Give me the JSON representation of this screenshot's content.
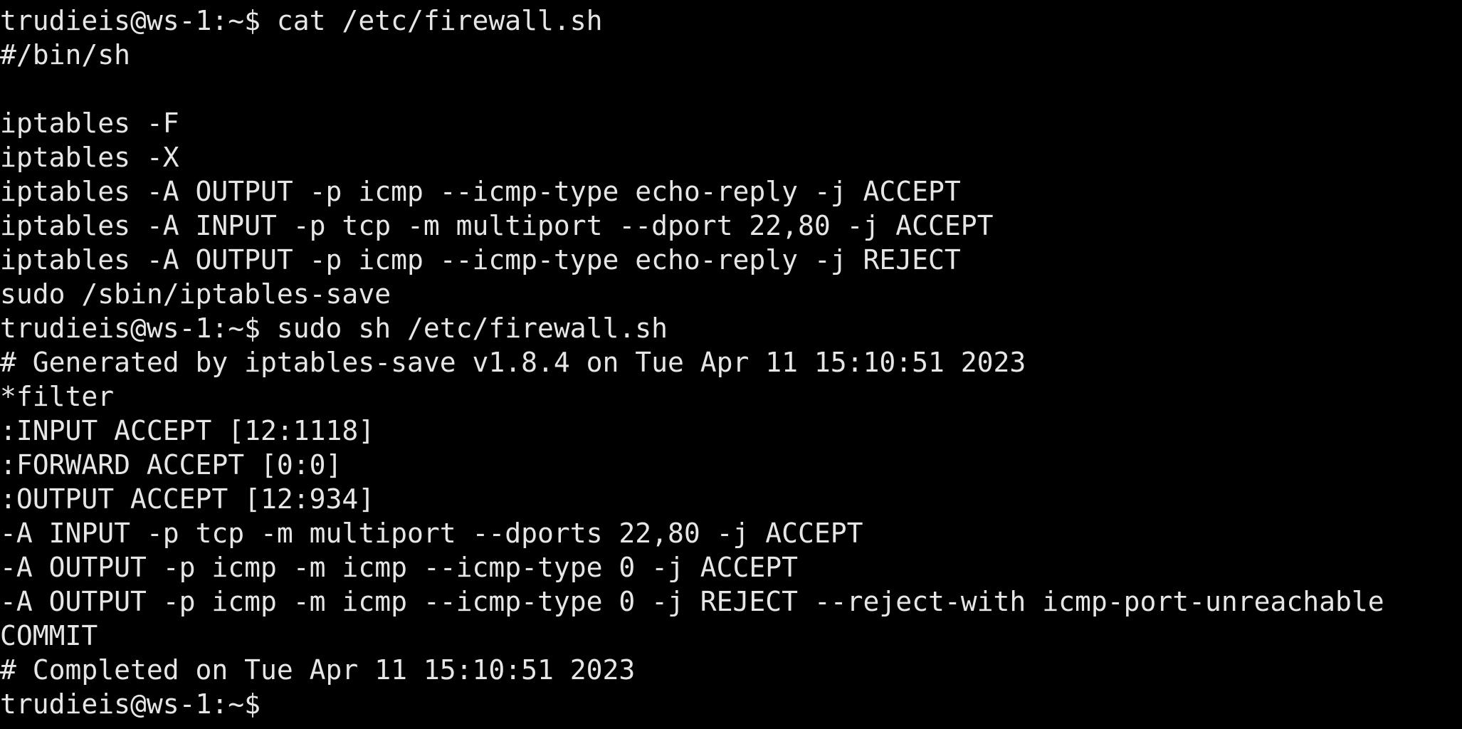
{
  "terminal": {
    "background_color": "#000000",
    "text_color": "#e6e6e6",
    "prompt": "trudieis@ws-1:~$",
    "lines": [
      "trudieis@ws-1:~$ cat /etc/firewall.sh",
      "#/bin/sh",
      "",
      "iptables -F",
      "iptables -X",
      "iptables -A OUTPUT -p icmp --icmp-type echo-reply -j ACCEPT",
      "iptables -A INPUT -p tcp -m multiport --dport 22,80 -j ACCEPT",
      "iptables -A OUTPUT -p icmp --icmp-type echo-reply -j REJECT",
      "sudo /sbin/iptables-save",
      "trudieis@ws-1:~$ sudo sh /etc/firewall.sh",
      "# Generated by iptables-save v1.8.4 on Tue Apr 11 15:10:51 2023",
      "*filter",
      ":INPUT ACCEPT [12:1118]",
      ":FORWARD ACCEPT [0:0]",
      ":OUTPUT ACCEPT [12:934]",
      "-A INPUT -p tcp -m multiport --dports 22,80 -j ACCEPT",
      "-A OUTPUT -p icmp -m icmp --icmp-type 0 -j ACCEPT",
      "-A OUTPUT -p icmp -m icmp --icmp-type 0 -j REJECT --reject-with icmp-port-unreachable",
      "COMMIT",
      "# Completed on Tue Apr 11 15:10:51 2023",
      "trudieis@ws-1:~$"
    ]
  }
}
